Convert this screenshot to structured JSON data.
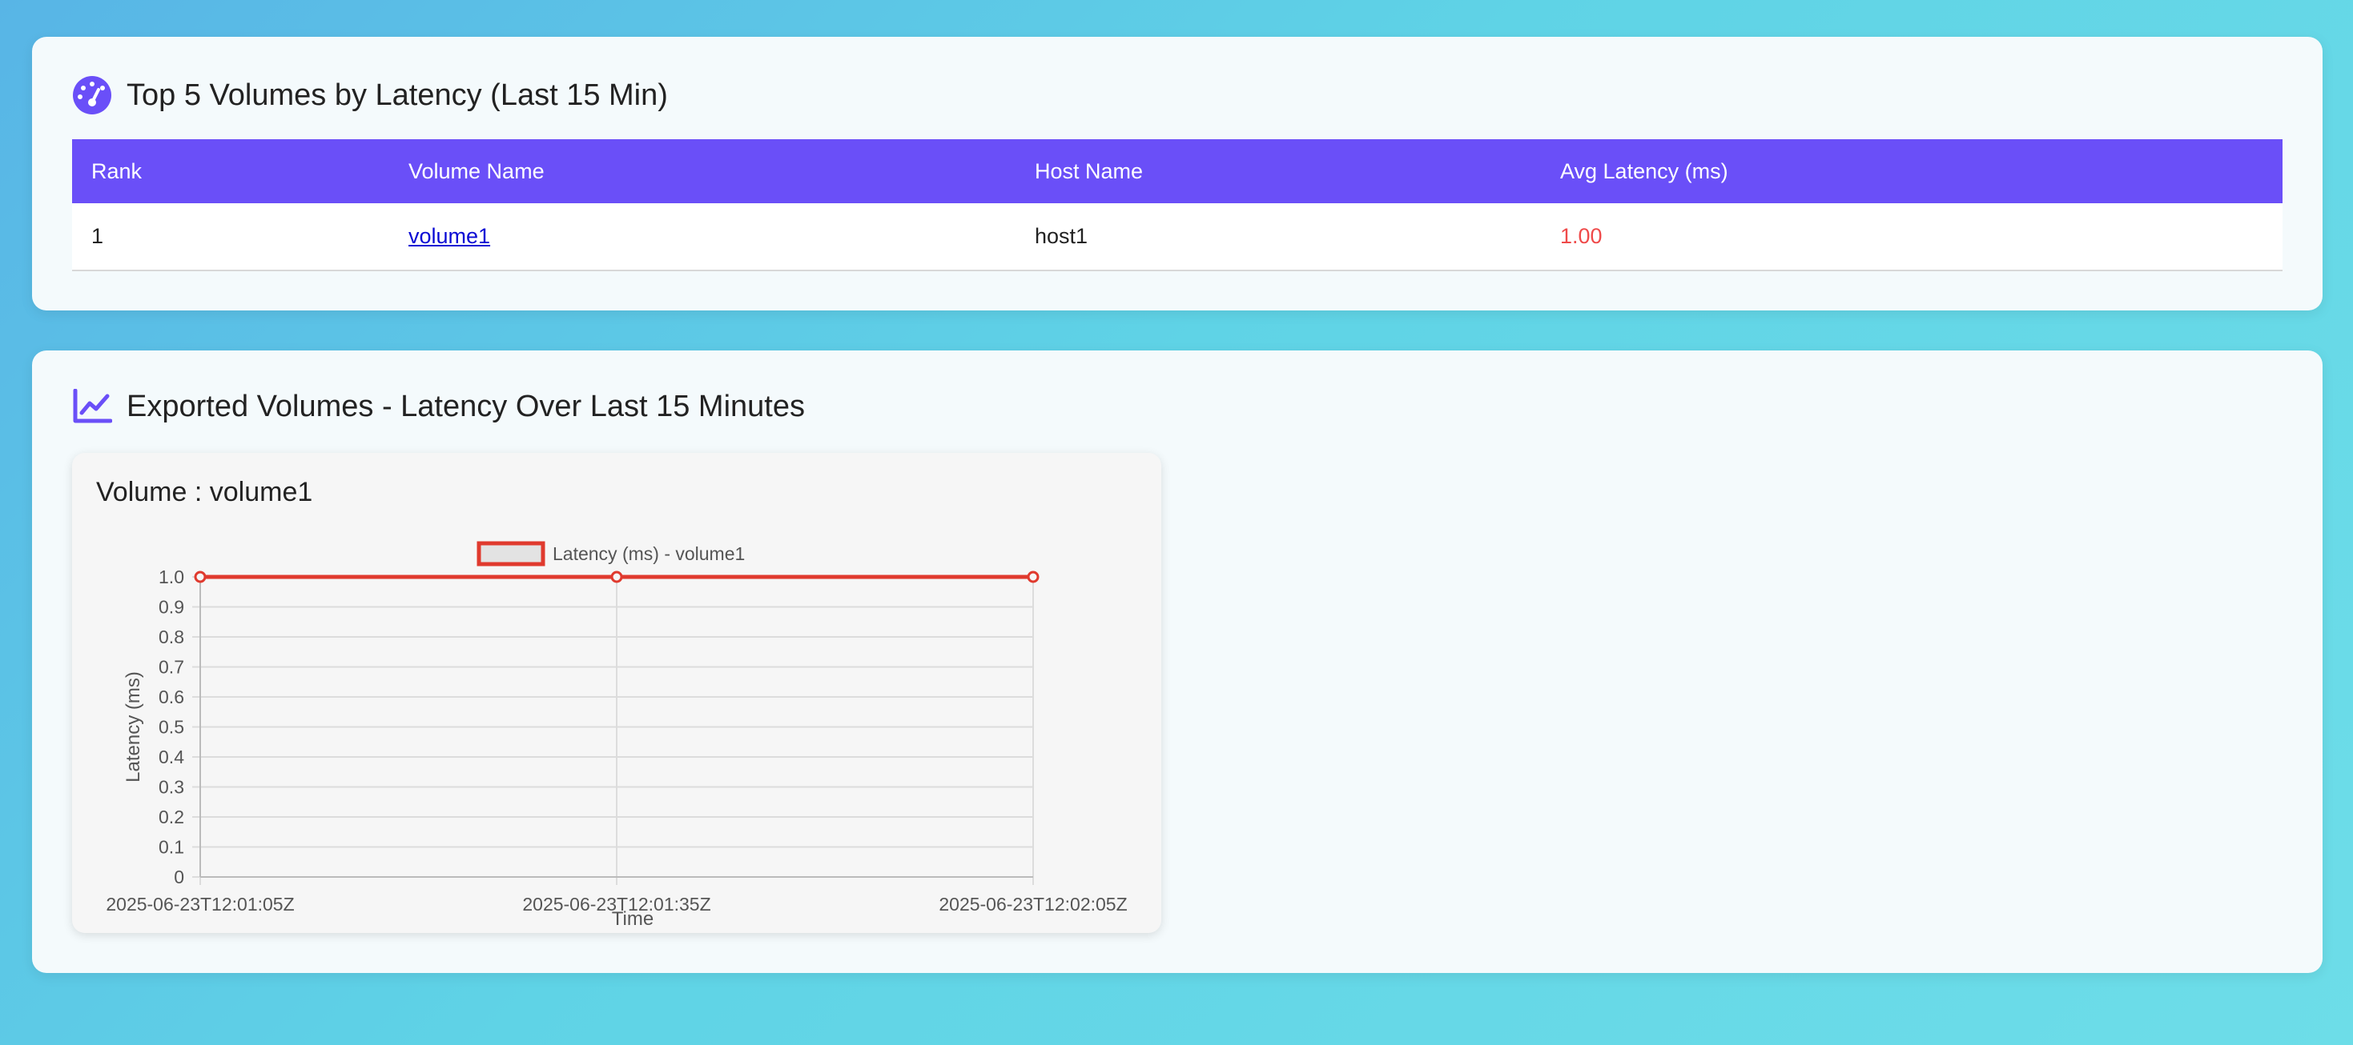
{
  "top_volumes": {
    "title": "Top 5 Volumes by Latency (Last 15 Min)",
    "columns": [
      "Rank",
      "Volume Name",
      "Host Name",
      "Avg Latency (ms)"
    ],
    "rows": [
      {
        "rank": "1",
        "volume": "volume1",
        "host": "host1",
        "latency": "1.00"
      }
    ]
  },
  "exported": {
    "title": "Exported Volumes - Latency Over Last 15 Minutes",
    "chart_card_title": "Volume : volume1"
  },
  "colors": {
    "accent": "#6a4ff8",
    "series_line": "#e03a2e",
    "latency_text": "#ef4a4a"
  },
  "chart_data": {
    "type": "line",
    "x": [
      "2025-06-23T12:01:05Z",
      "2025-06-23T12:01:35Z",
      "2025-06-23T12:02:05Z"
    ],
    "series": [
      {
        "name": "Latency (ms) - volume1",
        "values": [
          1.0,
          1.0,
          1.0
        ],
        "color": "#e03a2e"
      }
    ],
    "xlabel": "Time",
    "ylabel": "Latency (ms)",
    "ylim": [
      0,
      1.0
    ],
    "yticks": [
      "0",
      "0.1",
      "0.2",
      "0.3",
      "0.4",
      "0.5",
      "0.6",
      "0.7",
      "0.8",
      "0.9",
      "1.0"
    ],
    "grid": true,
    "legend": "top-center"
  }
}
